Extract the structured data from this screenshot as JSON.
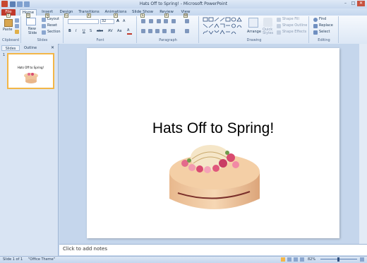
{
  "window": {
    "title": "Hats Off to Spring! - Microsoft PowerPoint",
    "controls": [
      "–",
      "□",
      "✕"
    ]
  },
  "tabs": [
    {
      "label": "File",
      "key": "F"
    },
    {
      "label": "Home",
      "key": "H"
    },
    {
      "label": "Insert",
      "key": "N"
    },
    {
      "label": "Design",
      "key": "G"
    },
    {
      "label": "Transitions",
      "key": "K"
    },
    {
      "label": "Animations",
      "key": "A"
    },
    {
      "label": "Slide Show",
      "key": "S"
    },
    {
      "label": "Review",
      "key": "R"
    },
    {
      "label": "View",
      "key": "W"
    }
  ],
  "ribbon": {
    "clipboard": {
      "paste": "Paste",
      "label": "Clipboard"
    },
    "slides": {
      "new_slide": "New Slide",
      "layout": "Layout",
      "reset": "Reset",
      "section": "Section",
      "label": "Slides"
    },
    "font": {
      "font_name": "",
      "font_size": "32",
      "label": "Font"
    },
    "paragraph": {
      "label": "Paragraph"
    },
    "drawing": {
      "arrange": "Arrange",
      "quick_styles": "Quick Styles",
      "shape_fill": "Shape Fill",
      "shape_outline": "Shape Outline",
      "shape_effects": "Shape Effects",
      "label": "Drawing"
    },
    "editing": {
      "find": "Find",
      "replace": "Replace",
      "select": "Select",
      "label": "Editing"
    }
  },
  "panel": {
    "tab_slides": "Slides",
    "tab_outline": "Outline",
    "close": "✕",
    "thumb_number": "1",
    "thumb_title": "Hats Off to Spring!"
  },
  "slide": {
    "title": "Hats Off to Spring!"
  },
  "notes": {
    "placeholder": "Click to add notes"
  },
  "status": {
    "slide": "Slide 1 of 1",
    "theme": "\"Office Theme\"",
    "zoom": "82%"
  },
  "colors": {
    "file_tab": "#c0392b",
    "accent": "#f3b648"
  }
}
